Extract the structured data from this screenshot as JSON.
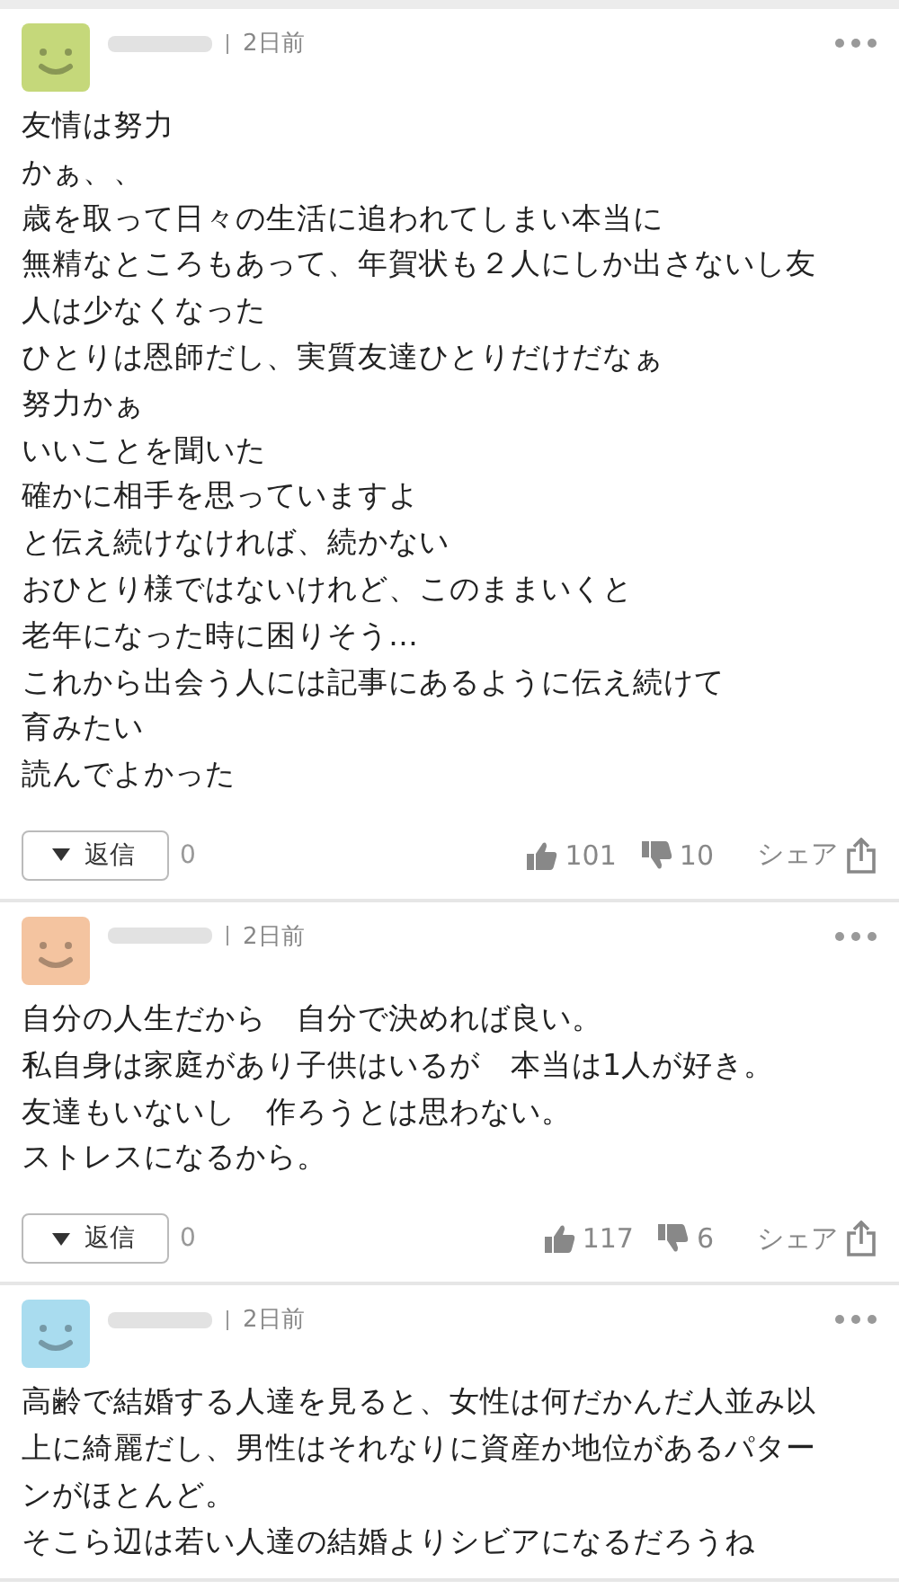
{
  "comments": [
    {
      "time": "2日前",
      "color": "#c5d87a",
      "lines": [
        "友情は努力",
        "かぁ、、",
        "歳を取って日々の生活に追われてしまい本当に",
        "無精なところもあって、年賀状も２人にしか出さないし友",
        "人は少なくなった",
        "ひとりは恩師だし、実質友達ひとりだけだなぁ",
        "努力かぁ",
        "いいことを聞いた",
        "確かに相手を思っていますよ",
        "と伝え続けなければ、続かない",
        "おひとり様ではないけれど、このままいくと",
        "老年になった時に困りそう…",
        "これから出会う人には記事にあるように伝え続けて",
        "育みたい",
        "読んでよかった"
      ],
      "reply_label": "返信",
      "reply_count": "0",
      "likes": "101",
      "dislikes": "10",
      "share_label": "シェア"
    },
    {
      "time": "2日前",
      "color": "#f4c4a0",
      "lines": [
        "自分の人生だから　自分で決めれば良い。",
        "私自身は家庭があり子供はいるが　本当は1人が好き。",
        "友達もいないし　作ろうとは思わない。",
        "ストレスになるから。"
      ],
      "reply_label": "返信",
      "reply_count": "0",
      "likes": "117",
      "dislikes": "6",
      "share_label": "シェア"
    },
    {
      "time": "2日前",
      "color": "#a9dcef",
      "lines": [
        "高齢で結婚する人達を見ると、女性は何だかんだ人並み以",
        "上に綺麗だし、男性はそれなりに資産か地位があるパター",
        "ンがほとんど。",
        "そこら辺は若い人達の結婚よりシビアになるだろうね"
      ]
    }
  ]
}
